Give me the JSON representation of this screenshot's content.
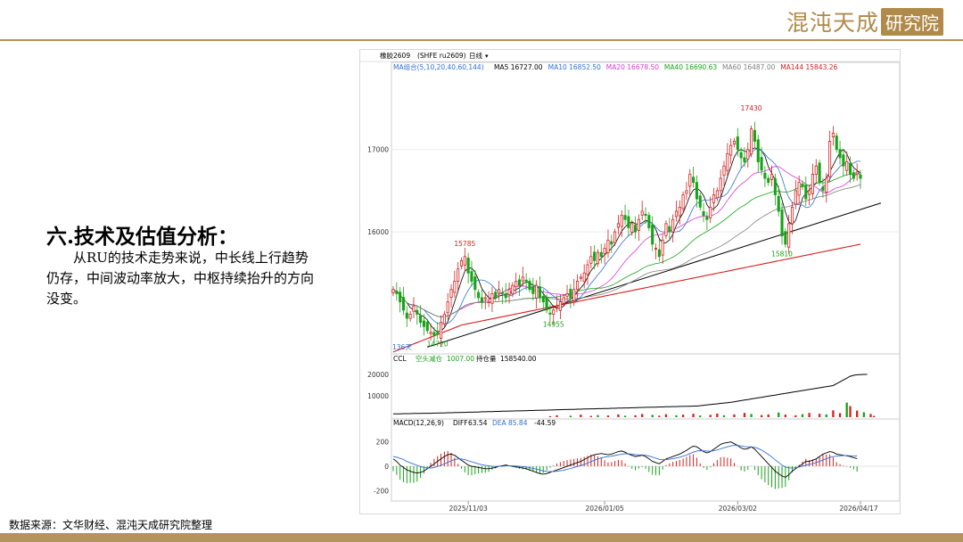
{
  "brand": {
    "name": "混沌天成",
    "box": "研究院"
  },
  "section": {
    "title": "六.技术及估值分析：",
    "body": "从RU的技术走势来说，中长线上行趋势仍存，中间波动率放大，中枢持续抬升的方向没变。"
  },
  "source": "数据来源：文华财经、混沌天成研究院整理",
  "chart_data": {
    "type": "candlestick",
    "contract": "橡胶2609",
    "code": "(SHFE ru2609)",
    "period": "日线",
    "days_label": "136天",
    "x_ticks": [
      "2025/11/03",
      "2026/01/05",
      "2026/03/02",
      "2026/04/17"
    ],
    "price_axis": {
      "ticks": [
        16000,
        17000
      ],
      "range": [
        14550,
        17950
      ]
    },
    "ma": {
      "label": "MA组合(5,10,20,40,60,144)",
      "values": [
        {
          "name": "MA5",
          "value": "16727.00",
          "color": "#000000"
        },
        {
          "name": "MA10",
          "value": "16852.50",
          "color": "#2f6fd6"
        },
        {
          "name": "MA20",
          "value": "16678.50",
          "color": "#d63ad6"
        },
        {
          "name": "MA40",
          "value": "16690.63",
          "color": "#17a317"
        },
        {
          "name": "MA60",
          "value": "16487.00",
          "color": "#808080"
        },
        {
          "name": "MA144",
          "value": "15843.26",
          "color": "#d62020"
        }
      ]
    },
    "annotations": [
      {
        "label": "15785",
        "index": 21,
        "value": 15785,
        "pos": "above",
        "color": "#d62020"
      },
      {
        "label": "14720",
        "index": 13,
        "value": 14720,
        "pos": "below",
        "color": "#17a317"
      },
      {
        "label": "14955",
        "index": 47,
        "value": 14955,
        "pos": "below",
        "color": "#17a317"
      },
      {
        "label": "17430",
        "index": 105,
        "value": 17430,
        "pos": "above",
        "color": "#d62020"
      },
      {
        "label": "15810",
        "index": 114,
        "value": 15810,
        "pos": "below",
        "color": "#17a317"
      }
    ],
    "trendline": {
      "from": [
        10,
        14600
      ],
      "to": [
        143,
        16350
      ]
    },
    "ccl": {
      "label": "CCL",
      "short_label": "空头减仓",
      "short_value": "1007.00",
      "oi_label": "持仓量",
      "oi_value": "158540.00",
      "ticks": [
        10000,
        20000
      ],
      "range": [
        0,
        25000
      ]
    },
    "macd": {
      "label": "MACD(12,26,9)",
      "diff_label": "DIFF",
      "diff": "63.54",
      "dea_label": "DEA",
      "dea": "85.84",
      "hist": "-44.59",
      "ticks": [
        200,
        0,
        -200
      ],
      "range": [
        -270,
        300
      ]
    },
    "closes": [
      15300,
      15250,
      15150,
      15050,
      14950,
      15000,
      15100,
      15000,
      14900,
      14850,
      14800,
      14780,
      14740,
      14760,
      14900,
      15000,
      15150,
      15300,
      15400,
      15550,
      15650,
      15700,
      15500,
      15400,
      15300,
      15200,
      15150,
      15200,
      15150,
      15250,
      15200,
      15300,
      15250,
      15200,
      15300,
      15350,
      15400,
      15350,
      15450,
      15400,
      15300,
      15250,
      15350,
      15200,
      15150,
      15050,
      15000,
      15050,
      15100,
      15150,
      15200,
      15250,
      15200,
      15300,
      15400,
      15450,
      15500,
      15600,
      15700,
      15650,
      15750,
      15700,
      15800,
      15900,
      15850,
      16000,
      16100,
      16200,
      16150,
      16050,
      16100,
      16000,
      16150,
      16250,
      16200,
      16050,
      15850,
      15800,
      15700,
      15900,
      16100,
      16000,
      16150,
      16250,
      16300,
      16450,
      16500,
      16700,
      16600,
      16400,
      16300,
      16200,
      16150,
      16300,
      16450,
      16500,
      16650,
      16800,
      16950,
      17050,
      17100,
      17000,
      16900,
      16850,
      17000,
      17250,
      17100,
      16850,
      16750,
      16650,
      16600,
      16700,
      16450,
      16250,
      15950,
      15850,
      16100,
      16300,
      16500,
      16600,
      16550,
      16400,
      16500,
      16700,
      16800,
      16600,
      16500,
      16650,
      17100,
      17200,
      17000,
      16900,
      16800,
      16850,
      16700,
      16650,
      16727,
      16650
    ],
    "oi": [
      1.8,
      1.8,
      1.8,
      1.9,
      1.9,
      1.9,
      2.0,
      2.0,
      2.0,
      2.1,
      2.1,
      2.1,
      2.2,
      2.2,
      2.3,
      2.3,
      2.4,
      2.4,
      2.5,
      2.5,
      2.6,
      2.6,
      2.7,
      2.7,
      2.8,
      2.8,
      2.9,
      2.9,
      3.0,
      3.0,
      3.1,
      3.1,
      3.2,
      3.2,
      3.3,
      3.3,
      3.4,
      3.4,
      3.5,
      3.5,
      3.6,
      3.6,
      3.7,
      3.7,
      3.8,
      3.8,
      3.9,
      3.9,
      4.0,
      4.0,
      4.1,
      4.1,
      4.2,
      4.2,
      4.3,
      4.3,
      4.4,
      4.4,
      4.5,
      4.5,
      4.6,
      4.6,
      4.7,
      4.7,
      4.8,
      4.8,
      4.9,
      4.9,
      5.0,
      5.0,
      5.1,
      5.1,
      5.2,
      5.2,
      5.3,
      5.3,
      5.4,
      5.4,
      5.5,
      5.5,
      5.6,
      5.6,
      5.7,
      5.7,
      5.8,
      5.8,
      5.9,
      5.9,
      6.0,
      6.0,
      6.2,
      6.4,
      6.6,
      6.8,
      7.0,
      7.2,
      7.4,
      7.6,
      7.8,
      8.0,
      8.3,
      8.6,
      8.9,
      9.2,
      9.5,
      9.8,
      10.1,
      10.4,
      10.7,
      11.0,
      11.3,
      11.6,
      11.9,
      12.2,
      12.5,
      12.8,
      13.1,
      13.4,
      13.7,
      14.0,
      14.3,
      14.6,
      14.9,
      15.2,
      15.5,
      15.8,
      16.1,
      16.4,
      16.7,
      17.0,
      18.0,
      19.0,
      20.0,
      21.0,
      22.0,
      22.5,
      22.8,
      22.9,
      23.0,
      23.0
    ],
    "volume": [
      0,
      0,
      0,
      0,
      0,
      0,
      0,
      0,
      0,
      0,
      0,
      0,
      0,
      0,
      0,
      0,
      0,
      0,
      0,
      0,
      0,
      0,
      0,
      0,
      0,
      0,
      0,
      0,
      0,
      0,
      0,
      0,
      0,
      0,
      0,
      0,
      0,
      0,
      0,
      0,
      0,
      0,
      0,
      0,
      0,
      0,
      0,
      0,
      0,
      0,
      0,
      0,
      0,
      0,
      0,
      0,
      0,
      0,
      0,
      0,
      0,
      0,
      0,
      0,
      0,
      0,
      0,
      0,
      0,
      0,
      0,
      0,
      0,
      0,
      0,
      0,
      0,
      0,
      0,
      0,
      0,
      0,
      0,
      0,
      0,
      0,
      0,
      0,
      0,
      0,
      0,
      0,
      0,
      0,
      0,
      0,
      0,
      0,
      0,
      0,
      0,
      0,
      0,
      0,
      0,
      0,
      0,
      0,
      0,
      0,
      0,
      0,
      0,
      0,
      0,
      0,
      0,
      0,
      0,
      0,
      0,
      0,
      0,
      0,
      0,
      0,
      0,
      0,
      0,
      0,
      0,
      0,
      0,
      0,
      0,
      0,
      0,
      0,
      0,
      0,
      0
    ],
    "volume_bars": [
      [
        46,
        500
      ],
      [
        48,
        900
      ],
      [
        52,
        700
      ],
      [
        55,
        1200
      ],
      [
        58,
        600
      ],
      [
        60,
        1000
      ],
      [
        63,
        800
      ],
      [
        66,
        1300
      ],
      [
        68,
        700
      ],
      [
        71,
        900
      ],
      [
        73,
        1500
      ],
      [
        76,
        1100
      ],
      [
        78,
        700
      ],
      [
        80,
        1400
      ],
      [
        83,
        900
      ],
      [
        85,
        1200
      ],
      [
        88,
        1600
      ],
      [
        90,
        800
      ],
      [
        93,
        1100
      ],
      [
        95,
        1700
      ],
      [
        97,
        900
      ],
      [
        100,
        1300
      ],
      [
        103,
        2000
      ],
      [
        105,
        1500
      ],
      [
        108,
        1000
      ],
      [
        110,
        1300
      ],
      [
        113,
        2200
      ],
      [
        115,
        1200
      ],
      [
        118,
        900
      ],
      [
        120,
        1400
      ],
      [
        122,
        2000
      ],
      [
        125,
        1600
      ],
      [
        127,
        1300
      ],
      [
        129,
        3200
      ],
      [
        131,
        1900
      ],
      [
        133,
        6800
      ],
      [
        134,
        5200
      ],
      [
        136,
        3100
      ],
      [
        138,
        2300
      ],
      [
        140,
        1500
      ],
      [
        141,
        600
      ]
    ],
    "macd_diff": [
      60,
      40,
      10,
      -10,
      -30,
      -40,
      -50,
      -55,
      -50,
      -40,
      -20,
      0,
      20,
      40,
      60,
      80,
      95,
      100,
      90,
      70,
      50,
      30,
      10,
      0,
      -5,
      -10,
      -15,
      -20,
      -20,
      -15,
      -10,
      0,
      5,
      10,
      5,
      0,
      -5,
      -10,
      -15,
      -20,
      -30,
      -40,
      -50,
      -60,
      -65,
      -60,
      -50,
      -40,
      -30,
      -20,
      -10,
      0,
      10,
      20,
      30,
      40,
      55,
      70,
      85,
      95,
      100,
      105,
      100,
      95,
      100,
      110,
      120,
      125,
      115,
      100,
      90,
      80,
      85,
      90,
      80,
      60,
      40,
      30,
      20,
      40,
      60,
      70,
      80,
      90,
      100,
      115,
      130,
      150,
      165,
      160,
      140,
      120,
      110,
      120,
      140,
      160,
      180,
      190,
      195,
      200,
      185,
      170,
      150,
      140,
      145,
      160,
      140,
      110,
      80,
      50,
      20,
      -10,
      -40,
      -60,
      -80,
      -90,
      -70,
      -40,
      -20,
      0,
      20,
      40,
      40,
      50,
      60,
      80,
      100,
      110,
      120,
      115,
      100,
      95,
      90,
      85,
      80,
      70,
      63.54
    ],
    "macd_dea": [
      80,
      75,
      65,
      55,
      40,
      28,
      18,
      8,
      -2,
      -10,
      -14,
      -14,
      -10,
      -2,
      8,
      20,
      32,
      45,
      55,
      60,
      60,
      55,
      46,
      37,
      28,
      20,
      13,
      7,
      3,
      0,
      -1,
      0,
      1,
      3,
      3,
      3,
      2,
      0,
      -3,
      -6,
      -11,
      -17,
      -23,
      -31,
      -38,
      -43,
      -44,
      -43,
      -41,
      -37,
      -32,
      -25,
      -18,
      -10,
      -2,
      6,
      16,
      27,
      38,
      50,
      60,
      69,
      75,
      79,
      83,
      88,
      94,
      100,
      103,
      102,
      100,
      96,
      94,
      93,
      90,
      84,
      75,
      66,
      57,
      54,
      55,
      58,
      62,
      68,
      74,
      83,
      92,
      104,
      116,
      125,
      128,
      127,
      125,
      124,
      127,
      134,
      143,
      152,
      160,
      168,
      171,
      171,
      167,
      162,
      159,
      159,
      155,
      146,
      133,
      116,
      97,
      76,
      53,
      31,
      9,
      -6,
      -13,
      -15,
      -12,
      -6,
      1,
      9,
      15,
      22,
      30,
      40,
      51,
      62,
      72,
      79,
      83,
      86,
      87,
      87,
      86,
      83,
      85.84
    ]
  }
}
